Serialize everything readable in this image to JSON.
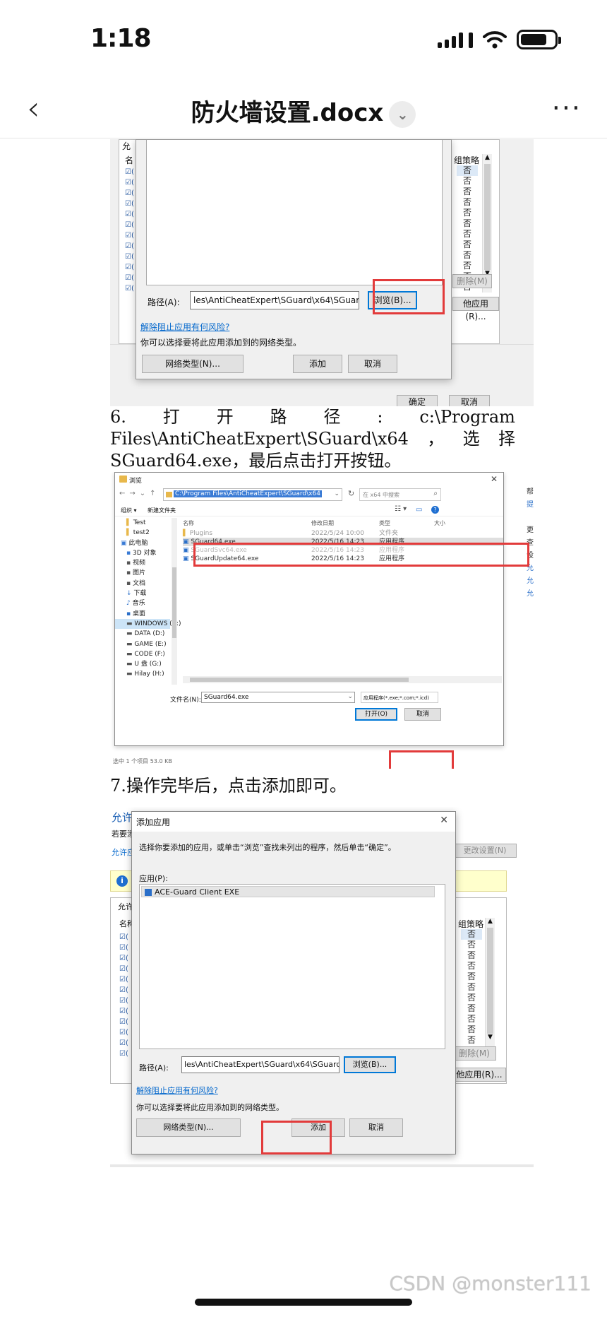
{
  "status_bar": {
    "time": "1:18"
  },
  "nav": {
    "back": "‹",
    "title": "防火墙设置.docx",
    "more": "···"
  },
  "shot1": {
    "col_header": "组策略",
    "col_values": [
      "否",
      "否",
      "否",
      "否",
      "否",
      "否",
      "否",
      "否",
      "否",
      "否",
      "否",
      "否"
    ],
    "path_label": "路径(A):",
    "path_value": "les\\AntiCheatExpert\\SGuard\\x64\\SGuard64.exe",
    "browse": "浏览(B)...",
    "risk_link": "解除阻止应用有何风险?",
    "network_hint": "你可以选择要将此应用添加到的网络类型。",
    "network_btn": "网络类型(N)...",
    "add": "添加",
    "cancel": "取消",
    "delete": "删除(M)",
    "other_app": "他应用(R)...",
    "ok": "确定",
    "cancel2": "取消",
    "left_name": "名",
    "left_allow": "允"
  },
  "para6": {
    "line1_num": "6.",
    "line1_words": [
      "打",
      "开",
      "路",
      "径",
      ":"
    ],
    "line1_end": "c:\\Program",
    "line2_a": "Files\\AntiCheatExpert\\SGuard\\x64",
    "line2_b": "，",
    "line2_c": "选",
    "line2_d": "择",
    "line3": "SGuard64.exe，最后点击打开按钮。"
  },
  "shot2": {
    "title": "浏览",
    "address": "C:\\Program Files\\AntiCheatExpert\\SGuard\\x64",
    "search": "在 x64 中搜索",
    "organize": "组织 ▾",
    "new_folder": "新建文件夹",
    "tree": [
      "Test",
      "test2",
      "此电脑",
      "3D 对象",
      "视频",
      "图片",
      "文档",
      "下载",
      "音乐",
      "桌面",
      "WINDOWS (C:)",
      "DATA (D:)",
      "GAME (E:)",
      "CODE (F:)",
      "U 盘 (G:)",
      "Hilay (H:)"
    ],
    "headers": {
      "name": "名称",
      "date": "修改日期",
      "type": "类型",
      "size": "大小"
    },
    "files": [
      {
        "name": "Plugins",
        "date": "2022/5/24 10:00",
        "type": "文件夹"
      },
      {
        "name": "SGuard64.exe",
        "date": "2022/5/16 14:23",
        "type": "应用程序"
      },
      {
        "name": "SGuardSvc64.exe",
        "date": "2022/5/16 14:23",
        "type": "应用程序"
      },
      {
        "name": "SGuardUpdate64.exe",
        "date": "2022/5/16 14:23",
        "type": "应用程序"
      }
    ],
    "filename_label": "文件名(N):",
    "filename_value": "SGuard64.exe",
    "filter": "应用程序(*.exe;*.com;*.icd)",
    "open": "打开(O)",
    "cancel": "取消",
    "right_labels": [
      "帮",
      "提",
      "更",
      "查",
      "设",
      "允",
      "允",
      "允",
      "允"
    ],
    "footer": "选中 1 个项目 53.0 KB"
  },
  "para7": "7.操作完毕后，点击添加即可。",
  "shot3": {
    "dialog_title": "添加应用",
    "close": "✕",
    "instruction": "选择你要添加的应用，或单击“浏览”查找未列出的程序，然后单击“确定”。",
    "apps_label": "应用(P):",
    "app_item": "ACE-Guard Client EXE",
    "path_label": "路径(A):",
    "path_value": "les\\AntiCheatExpert\\SGuard\\x64\\SGuard64.exe",
    "browse": "浏览(B)...",
    "risk_link": "解除阻止应用有何风险?",
    "network_hint": "你可以选择要将此应用添加到的网络类型。",
    "network_btn": "网络类型(N)...",
    "add": "添加",
    "cancel": "取消",
    "bg_allow": "允许",
    "bg_note": "若要添",
    "bg_link": "允许应",
    "bg_change": "更改设置(N)",
    "bg_name": "名称",
    "bg_allow2": "允许",
    "col_header": "组策略",
    "col_values": [
      "否",
      "否",
      "否",
      "否",
      "否",
      "否",
      "否",
      "否",
      "否",
      "否",
      "否",
      "否"
    ],
    "delete": "删除(M)",
    "other_app": "他应用(R)..."
  },
  "watermark": "CSDN @monster111"
}
